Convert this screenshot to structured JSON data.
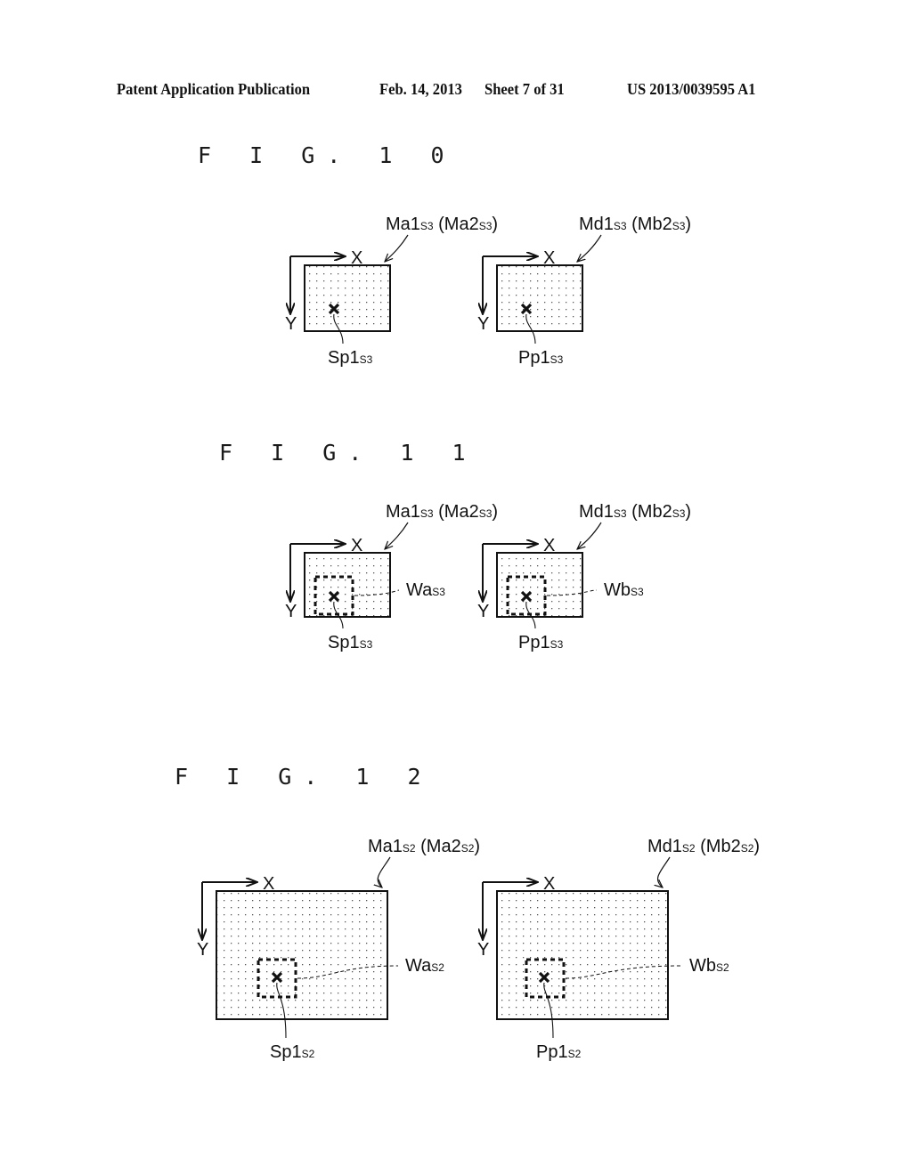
{
  "header": {
    "publication": "Patent Application Publication",
    "date": "Feb. 14, 2013",
    "sheet": "Sheet 7 of 31",
    "number": "US 2013/0039595 A1"
  },
  "figures": [
    {
      "title": "F I G. 1 0",
      "panels": [
        {
          "map_label": "Ma1",
          "map_sub": "S3",
          "alt_label": "(Ma2",
          "alt_sub": "S3",
          "alt_close": ")",
          "point_label": "Sp1",
          "point_sub": "S3",
          "axis_x": "X",
          "axis_y": "Y"
        },
        {
          "map_label": "Md1",
          "map_sub": "S3",
          "alt_label": "(Mb2",
          "alt_sub": "S3",
          "alt_close": ")",
          "point_label": "Pp1",
          "point_sub": "S3",
          "axis_x": "X",
          "axis_y": "Y"
        }
      ]
    },
    {
      "title": "F I G. 1 1",
      "panels": [
        {
          "map_label": "Ma1",
          "map_sub": "S3",
          "alt_label": "(Ma2",
          "alt_sub": "S3",
          "alt_close": ")",
          "point_label": "Sp1",
          "point_sub": "S3",
          "window_label": "Wa",
          "window_sub": "S3",
          "axis_x": "X",
          "axis_y": "Y"
        },
        {
          "map_label": "Md1",
          "map_sub": "S3",
          "alt_label": "(Mb2",
          "alt_sub": "S3",
          "alt_close": ")",
          "point_label": "Pp1",
          "point_sub": "S3",
          "window_label": "Wb",
          "window_sub": "S3",
          "axis_x": "X",
          "axis_y": "Y"
        }
      ]
    },
    {
      "title": "F I G. 1 2",
      "panels": [
        {
          "map_label": "Ma1",
          "map_sub": "S2",
          "alt_label": "(Ma2",
          "alt_sub": "S2",
          "alt_close": ")",
          "point_label": "Sp1",
          "point_sub": "S2",
          "window_label": "Wa",
          "window_sub": "S2",
          "axis_x": "X",
          "axis_y": "Y"
        },
        {
          "map_label": "Md1",
          "map_sub": "S2",
          "alt_label": "(Mb2",
          "alt_sub": "S2",
          "alt_close": ")",
          "point_label": "Pp1",
          "point_sub": "S2",
          "window_label": "Wb",
          "window_sub": "S2",
          "axis_x": "X",
          "axis_y": "Y"
        }
      ]
    }
  ]
}
